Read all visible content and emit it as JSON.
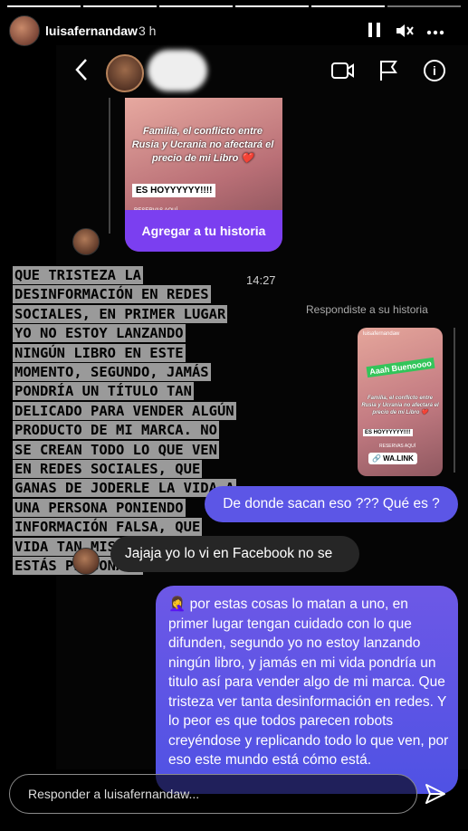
{
  "story_header": {
    "username": "luisafernandaw",
    "time": "3 h",
    "segments_total": 6,
    "segments_done": 5
  },
  "dm": {
    "back_icon": "chevron-left-icon",
    "header_icons": [
      "video-camera-icon",
      "flag-icon",
      "info-icon"
    ]
  },
  "shared_story": {
    "caption": "Familia, el conflicto entre Rusia y Ucrania no afectará el precio de mi Libro ❤️",
    "tag": "ES HOYYYYYY!!!!",
    "subtext": "RESERVAS AQUÍ",
    "button_label": "Agregar a tu historia"
  },
  "overlay_text": "QUE TRISTEZA LA DESINFORMACIÓN EN REDES SOCIALES, EN PRIMER LUGAR YO NO ESTOY LANZANDO NINGÚN LIBRO EN ESTE MOMENTO, SEGUNDO, JAMÁS PONDRÍA UN TÍTULO TAN DELICADO PARA VENDER ALGÚN PRODUCTO DE MI MARCA. NO SE CREAN TODO LO QUE VEN EN REDES SOCIALES, QUE GANAS DE JODERLE LA VIDA A UNA PERSONA PONIENDO INFORMACIÓN FALSA, QUE VIDA TAN MISERABLE LA DE ESTÁS PERSONAS.",
  "timestamp": "14:27",
  "replied_label": "Respondiste a su historia",
  "reply_story": {
    "mini_name": "luisafernandaw",
    "greeting": "Aaah Buenoooo",
    "caption": "Familia, el conflicto entre Rusia y Ucrania no afectará el precio de mi Libro ❤️",
    "tag": "ES HOYYYYYY!!!!",
    "subtext": "RESERVAS AQUÍ",
    "link": "🔗 WA.LINK"
  },
  "messages": [
    {
      "sender": "me",
      "text": "De donde sacan eso ??? Qué es ?"
    },
    {
      "sender": "them",
      "text": "Jajaja yo lo vi en Facebook no se"
    },
    {
      "sender": "me",
      "text": "🤦‍♀️ por estas cosas lo matan a uno, en primer lugar tengan cuidado con lo que difunden, segundo yo no estoy lanzando ningún libro, y jamás en mi vida pondría un titulo así para vender algo de mi marca. Que tristeza ver tanta desinformación en redes. Y lo peor es que todos parecen robots creyéndose y replicando todo lo que ven, por eso este mundo está cómo está."
    }
  ],
  "reply_input": {
    "placeholder": "Responder a luisafernandaw..."
  }
}
